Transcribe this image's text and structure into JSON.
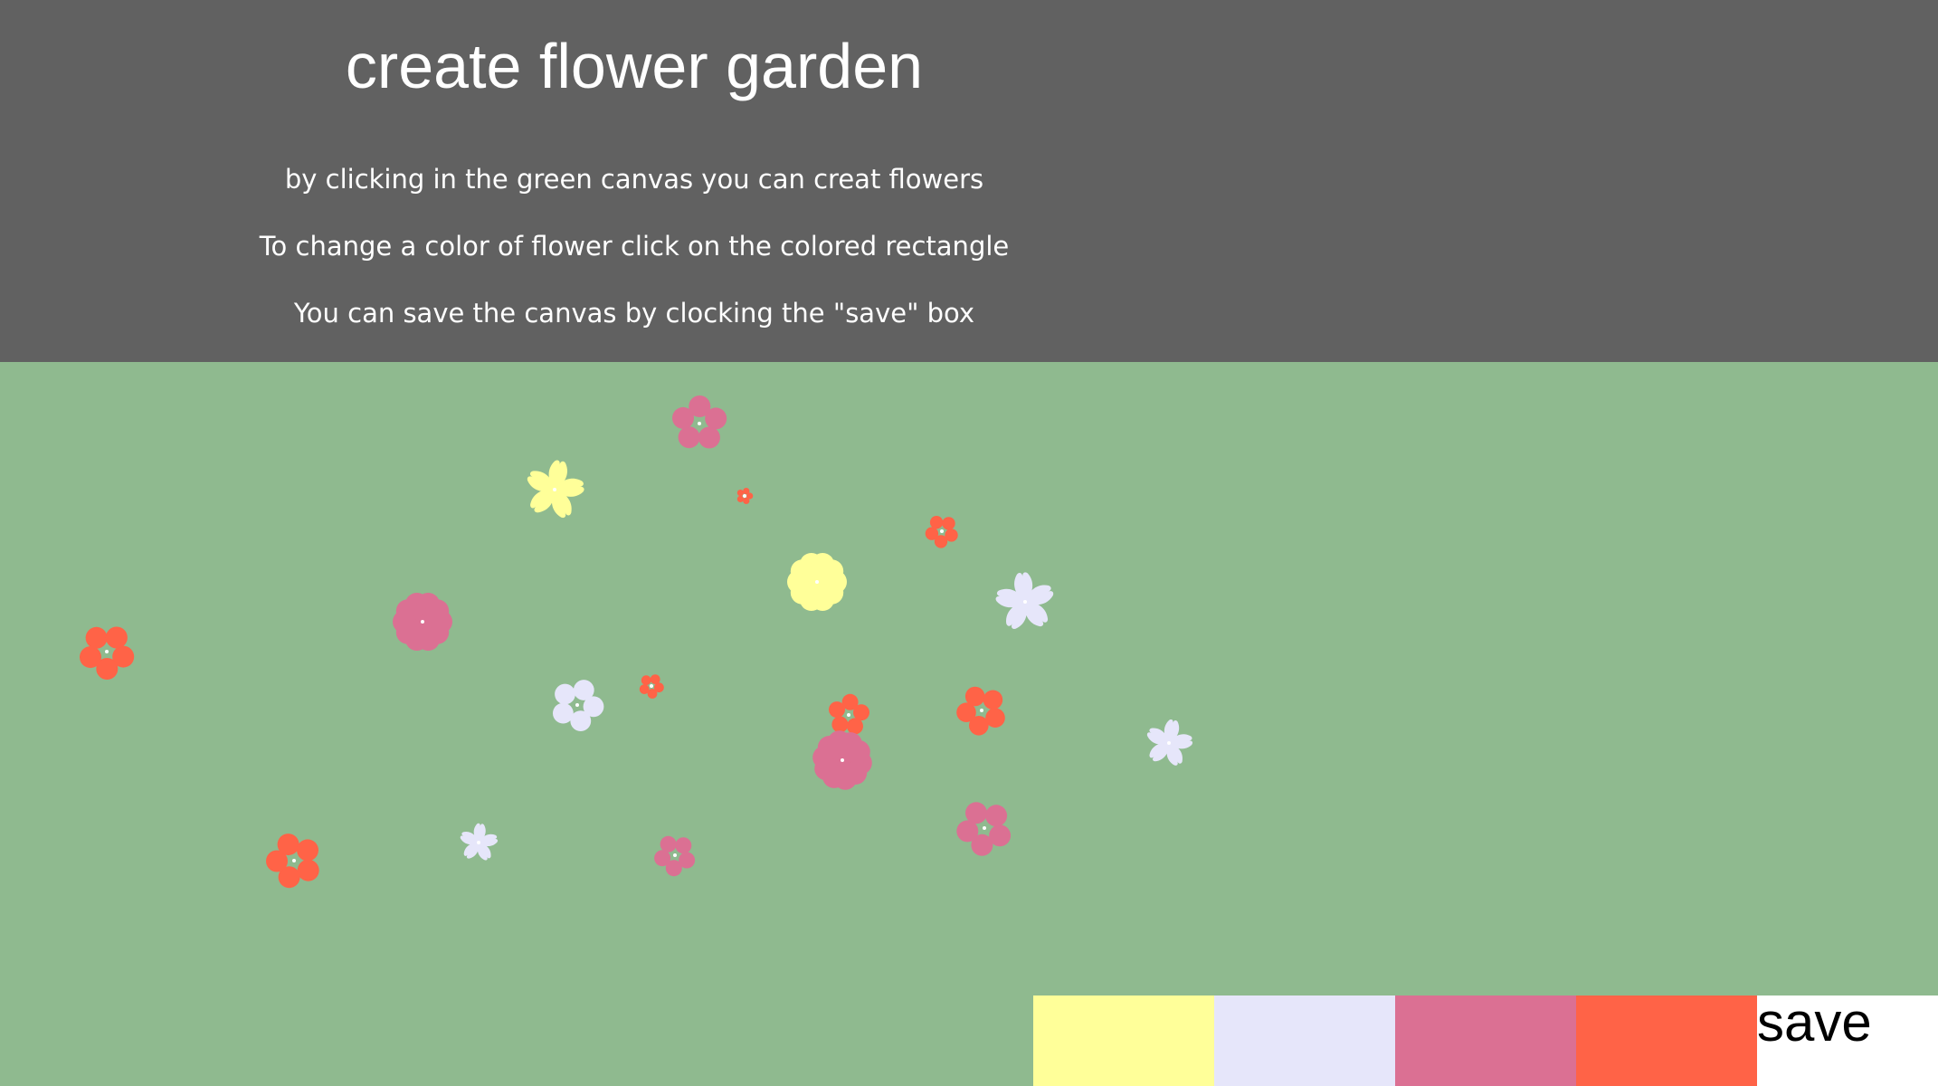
{
  "header": {
    "title": "create flower garden",
    "instructions": [
      "by clicking in the green canvas you can creat flowers",
      "To change a color of flower click on the colored rectangle",
      "You can save the canvas by clocking the \"save\" box"
    ]
  },
  "colors": {
    "header_bg": "#616161",
    "canvas_bg": "#8fba8f",
    "flower_center": "#ffffff"
  },
  "palette": [
    {
      "name": "yellow",
      "color": "#ffff99"
    },
    {
      "name": "lavender",
      "color": "#e6e6fa"
    },
    {
      "name": "pink",
      "color": "#db7093"
    },
    {
      "name": "tomato",
      "color": "#ff6347"
    }
  ],
  "save_button": {
    "label": "save"
  },
  "flowers": [
    {
      "color": "#db7093",
      "style": "round",
      "petals": 5
    },
    {
      "color": "#ffff99",
      "style": "heart",
      "petals": 5
    },
    {
      "color": "#ff6347",
      "style": "round",
      "petals": 5
    },
    {
      "color": "#ff6347",
      "style": "round",
      "petals": 5
    },
    {
      "color": "#ffff99",
      "style": "ruffle",
      "petals": 10
    },
    {
      "color": "#e6e6fa",
      "style": "heart",
      "petals": 5
    },
    {
      "color": "#db7093",
      "style": "ruffle",
      "petals": 10
    },
    {
      "color": "#ff6347",
      "style": "round",
      "petals": 5
    },
    {
      "color": "#e6e6fa",
      "style": "round",
      "petals": 5
    },
    {
      "color": "#ff6347",
      "style": "round",
      "petals": 5
    },
    {
      "color": "#ff6347",
      "style": "round",
      "petals": 5
    },
    {
      "color": "#ff6347",
      "style": "round",
      "petals": 5
    },
    {
      "color": "#db7093",
      "style": "ruffle",
      "petals": 10
    },
    {
      "color": "#e6e6fa",
      "style": "heart",
      "petals": 5
    },
    {
      "color": "#db7093",
      "style": "round",
      "petals": 5
    },
    {
      "color": "#ff6347",
      "style": "round",
      "petals": 5
    },
    {
      "color": "#e6e6fa",
      "style": "heart",
      "petals": 5
    },
    {
      "color": "#db7093",
      "style": "round",
      "petals": 5
    }
  ]
}
